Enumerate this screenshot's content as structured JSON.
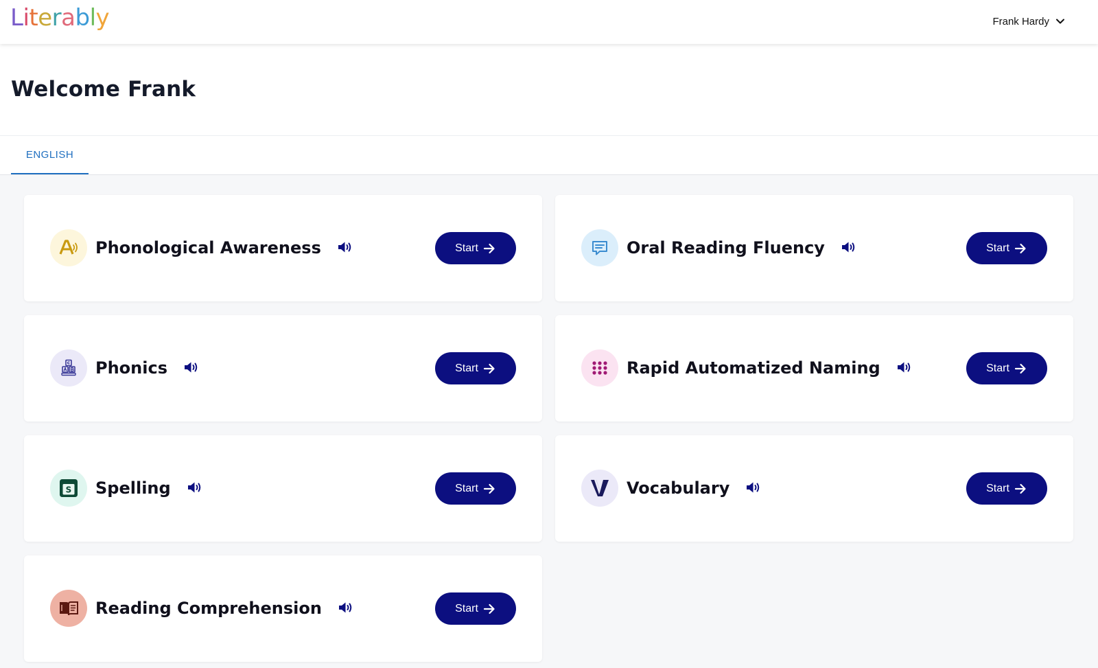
{
  "app": {
    "logo_letters": [
      {
        "ch": "L",
        "color": "#7a5cc9"
      },
      {
        "ch": "i",
        "color": "#d94a6a"
      },
      {
        "ch": "t",
        "color": "#e6733a"
      },
      {
        "ch": "e",
        "color": "#c9a93a"
      },
      {
        "ch": "r",
        "color": "#3fa2a8"
      },
      {
        "ch": "a",
        "color": "#e06a7a"
      },
      {
        "ch": "b",
        "color": "#3c9bd6"
      },
      {
        "ch": "l",
        "color": "#6dbb5a"
      },
      {
        "ch": "y",
        "color": "#f0a53a"
      }
    ],
    "user_name": "Frank Hardy"
  },
  "page": {
    "title": "Welcome Frank"
  },
  "tabs": [
    {
      "label": "ENGLISH",
      "active": true
    }
  ],
  "cards": [
    {
      "title": "Phonological Awareness",
      "icon": "letter-a-sound-icon",
      "icon_bg": "#fdf6dc",
      "icon_color": "#c99a10",
      "button": "Start"
    },
    {
      "title": "Oral Reading Fluency",
      "icon": "chat-bubble-icon",
      "icon_bg": "#dbeefb",
      "icon_color": "#3b8cd0",
      "button": "Start"
    },
    {
      "title": "Phonics",
      "icon": "letter-blocks-icon",
      "icon_bg": "#ebe9f8",
      "icon_color": "#3b3a98",
      "button": "Start"
    },
    {
      "title": "Rapid Automatized Naming",
      "icon": "dots-grid-icon",
      "icon_bg": "#fbe3f1",
      "icon_color": "#a01a74",
      "button": "Start"
    },
    {
      "title": "Spelling",
      "icon": "spelling-s-icon",
      "icon_bg": "#dff6ef",
      "icon_color": "#0e4a36",
      "button": "Start"
    },
    {
      "title": "Vocabulary",
      "icon": "vocabulary-v-icon",
      "icon_bg": "#ebe9f8",
      "icon_color": "#1a1a5c",
      "button": "Start"
    },
    {
      "title": "Reading Comprehension",
      "icon": "open-book-icon",
      "icon_bg": "#eeb1a3",
      "icon_color": "#5a1810",
      "button": "Start"
    }
  ],
  "colors": {
    "accent": "#0c0f80",
    "tab_active": "#1f6fc0",
    "background": "#f6f7f9"
  }
}
